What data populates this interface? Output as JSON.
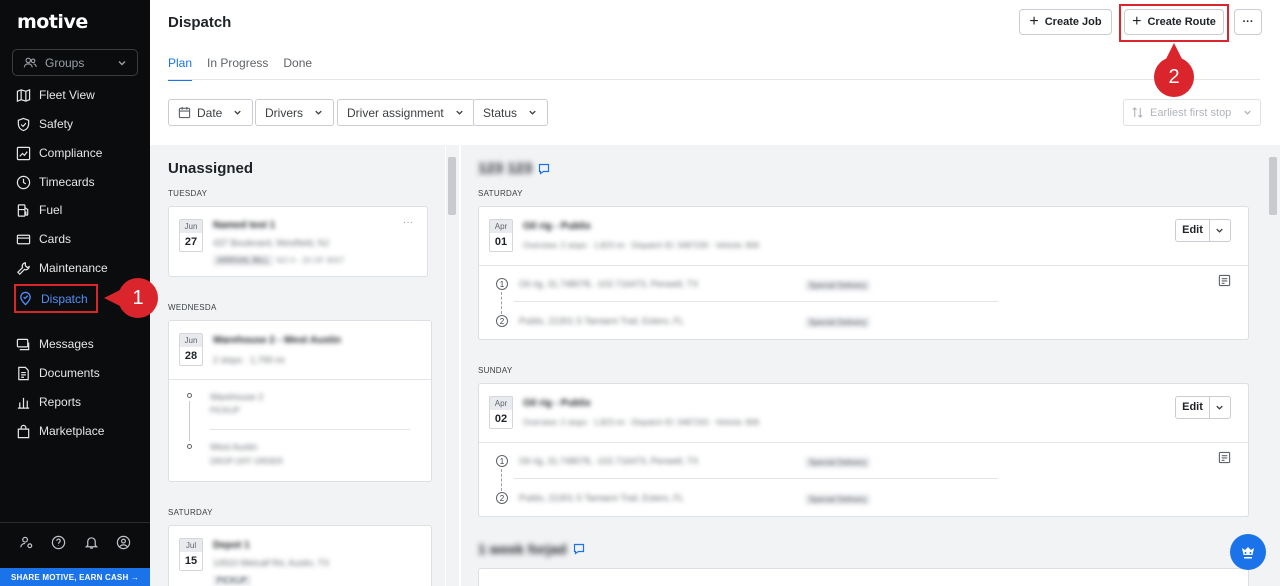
{
  "sidebar": {
    "logo": "motive",
    "groups_label": "Groups",
    "items": [
      {
        "label": "Fleet View"
      },
      {
        "label": "Safety"
      },
      {
        "label": "Compliance"
      },
      {
        "label": "Timecards"
      },
      {
        "label": "Fuel"
      },
      {
        "label": "Cards"
      },
      {
        "label": "Maintenance"
      },
      {
        "label": "Dispatch"
      },
      {
        "label": "Messages"
      },
      {
        "label": "Documents"
      },
      {
        "label": "Reports"
      },
      {
        "label": "Marketplace"
      }
    ],
    "share_label": "SHARE MOTIVE, EARN CASH →"
  },
  "header": {
    "title": "Dispatch",
    "create_job": "Create Job",
    "create_route": "Create Route",
    "more": "···"
  },
  "tabs": [
    {
      "label": "Plan"
    },
    {
      "label": "In Progress"
    },
    {
      "label": "Done"
    }
  ],
  "filters": {
    "date": "Date",
    "drivers": "Drivers",
    "driver_assignment": "Driver assignment",
    "status": "Status",
    "sort": "Earliest first stop"
  },
  "unassigned": {
    "title": "Unassigned",
    "groups": [
      {
        "day": "TUESDAY",
        "month": "Jun",
        "date": "27",
        "name": "Named test 1",
        "addr": "437 Boulevard, Westfield, NJ",
        "chip1": "ARRIVAL BILL",
        "chip2": "NO 0 - 20 OF 9007"
      },
      {
        "day": "WEDNESDA",
        "month": "Jun",
        "date": "28",
        "name": "Warehouse 2 - West Austin",
        "sub": "2 stops · 1,799 mi",
        "stop1": "Warehouse 2",
        "stop1_sub": "PICKUP",
        "stop2": "West Austin",
        "stop2_sub": "DROP-OFF ORDER"
      },
      {
        "day": "SATURDAY",
        "month": "Jul",
        "date": "15",
        "name": "Depot 1",
        "addr": "14910 Metcalf Rd, Austin, TX",
        "chip1": "PICKUP"
      }
    ]
  },
  "routes": {
    "title": "123 123",
    "items": [
      {
        "day": "SATURDAY",
        "month": "Apr",
        "date": "01",
        "name": "Oil rig - Publix",
        "sub": "Overview: 2 stops · 1,823 mi · Dispatch ID: 3487230 · Vehicle: 806",
        "edit": "Edit",
        "stops": [
          {
            "num": "1",
            "text": "Oil rig, 31.748078, -102.716473, Penwell, TX",
            "tag": "Special Delivery"
          },
          {
            "num": "2",
            "text": "Publix, 21301 S Tamiami Trail, Estero, FL",
            "tag": "Special Delivery"
          }
        ]
      },
      {
        "day": "SUNDAY",
        "month": "Apr",
        "date": "02",
        "name": "Oil rig - Publix",
        "sub": "Overview: 2 stops · 1,823 mi · Dispatch ID: 3487243 · Vehicle: 806",
        "edit": "Edit",
        "stops": [
          {
            "num": "1",
            "text": "Oil rig, 31.748078, -102.716473, Penwell, TX",
            "tag": "Special Delivery"
          },
          {
            "num": "2",
            "text": "Publix, 21301 S Tamiami Trail, Estero, FL",
            "tag": "Special Delivery"
          }
        ]
      }
    ],
    "next_title": "1 week forjad"
  },
  "annotations": {
    "marker1": "1",
    "marker2": "2"
  },
  "colors": {
    "accent": "#1a73e8",
    "annotation": "#d9252b",
    "sidebar_bg": "#0b0c0e"
  }
}
